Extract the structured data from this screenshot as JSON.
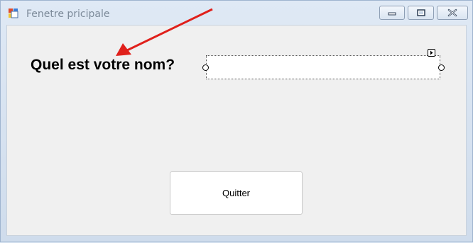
{
  "window": {
    "title": "Fenetre pricipale",
    "controls": {
      "minimize_icon": "minimize-icon",
      "maximize_icon": "maximize-icon",
      "close_icon": "close-icon"
    }
  },
  "form": {
    "question_label": "Quel est votre nom?",
    "name_input": {
      "value": "",
      "placeholder": ""
    },
    "quit_button_label": "Quitter"
  },
  "annotation": {
    "arrow_color": "#e0201b"
  }
}
